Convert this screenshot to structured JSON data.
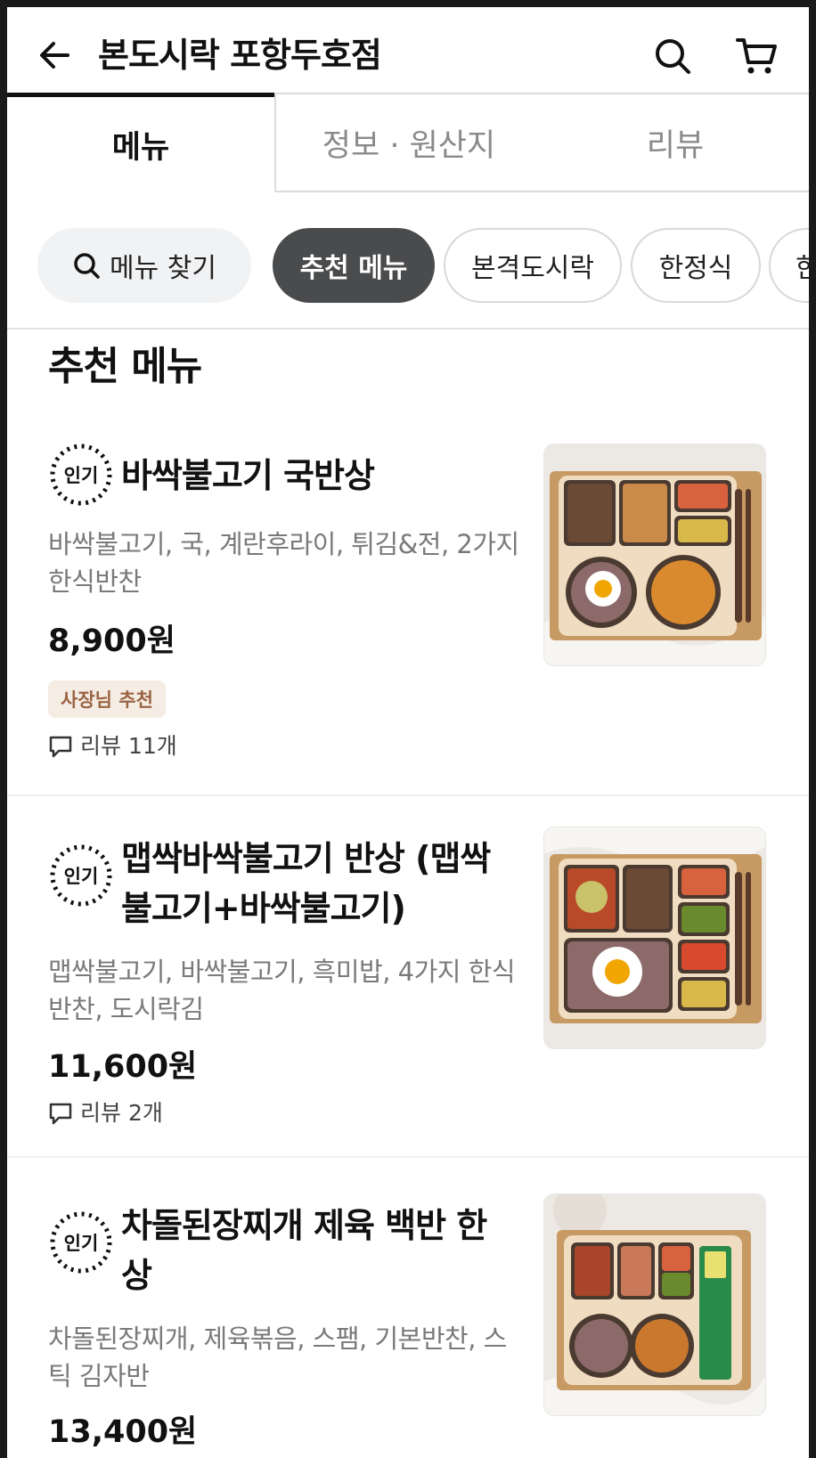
{
  "header": {
    "title": "본도시락 포항두호점",
    "back_icon": "arrow-left-icon",
    "search_icon": "search-icon",
    "cart_icon": "cart-icon"
  },
  "tabs": [
    {
      "label": "메뉴",
      "active": true
    },
    {
      "label": "정보 · 원산지",
      "active": false
    },
    {
      "label": "리뷰",
      "active": false
    }
  ],
  "chips": {
    "search_label": "메뉴 찾기",
    "items": [
      {
        "label": "추천 메뉴",
        "active": true
      },
      {
        "label": "본격도시락",
        "active": false
      },
      {
        "label": "한정식",
        "active": false
      },
      {
        "label": "한",
        "active": false
      }
    ]
  },
  "section": {
    "title": "추천 메뉴"
  },
  "popular_badge": "인기",
  "items": [
    {
      "name": "바싹불고기 국반상",
      "desc": "바싹불고기, 국, 계란후라이, 튀김&전, 2가지 한식반찬",
      "price": "8,900원",
      "owner_badge": "사장님 추천",
      "review": "리뷰 11개"
    },
    {
      "name": "맵싹바싹불고기 반상 (맵싹불고기+바싹불고기)",
      "desc": "맵싹불고기, 바싹불고기, 흑미밥, 4가지 한식 반찬, 도시락김",
      "price": "11,600원",
      "review": "리뷰 2개"
    },
    {
      "name": "차돌된장찌개 제육 백반 한상",
      "desc": "차돌된장찌개, 제육볶음, 스팸, 기본반찬, 스틱 김자반",
      "price": "13,400원"
    }
  ],
  "colors": {
    "active_chip": "#4a4b4d",
    "owner_badge_bg": "#f5ece4",
    "owner_badge_text": "#9a6544",
    "muted_text": "#7a7a7a"
  }
}
